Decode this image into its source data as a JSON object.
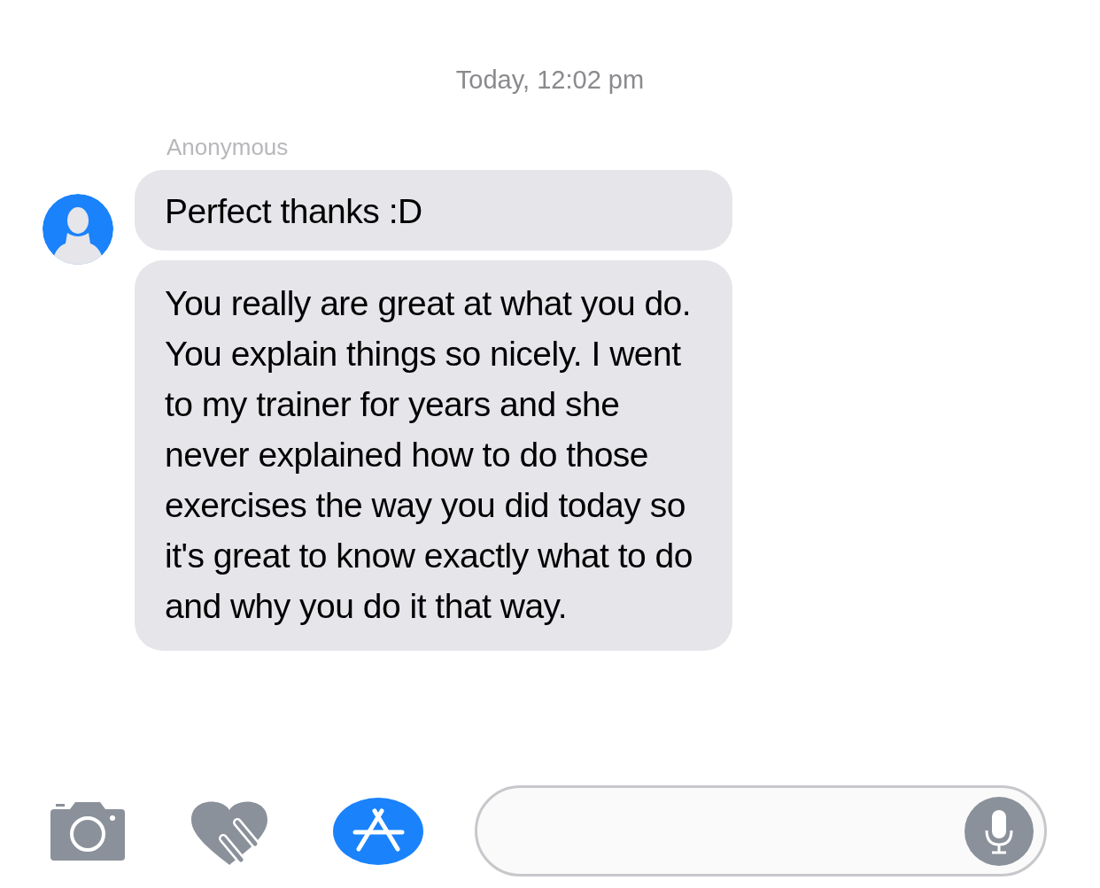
{
  "timestamp": "Today, 12:02 pm",
  "sender": "Anonymous",
  "messages": [
    {
      "text": "Perfect thanks :D"
    },
    {
      "text": "You really are great at what you do. You explain things so nicely. I went to my trainer for years and she never explained how to do those exercises the way you did today so it's great to know exactly what to do and why you do it that way."
    }
  ]
}
